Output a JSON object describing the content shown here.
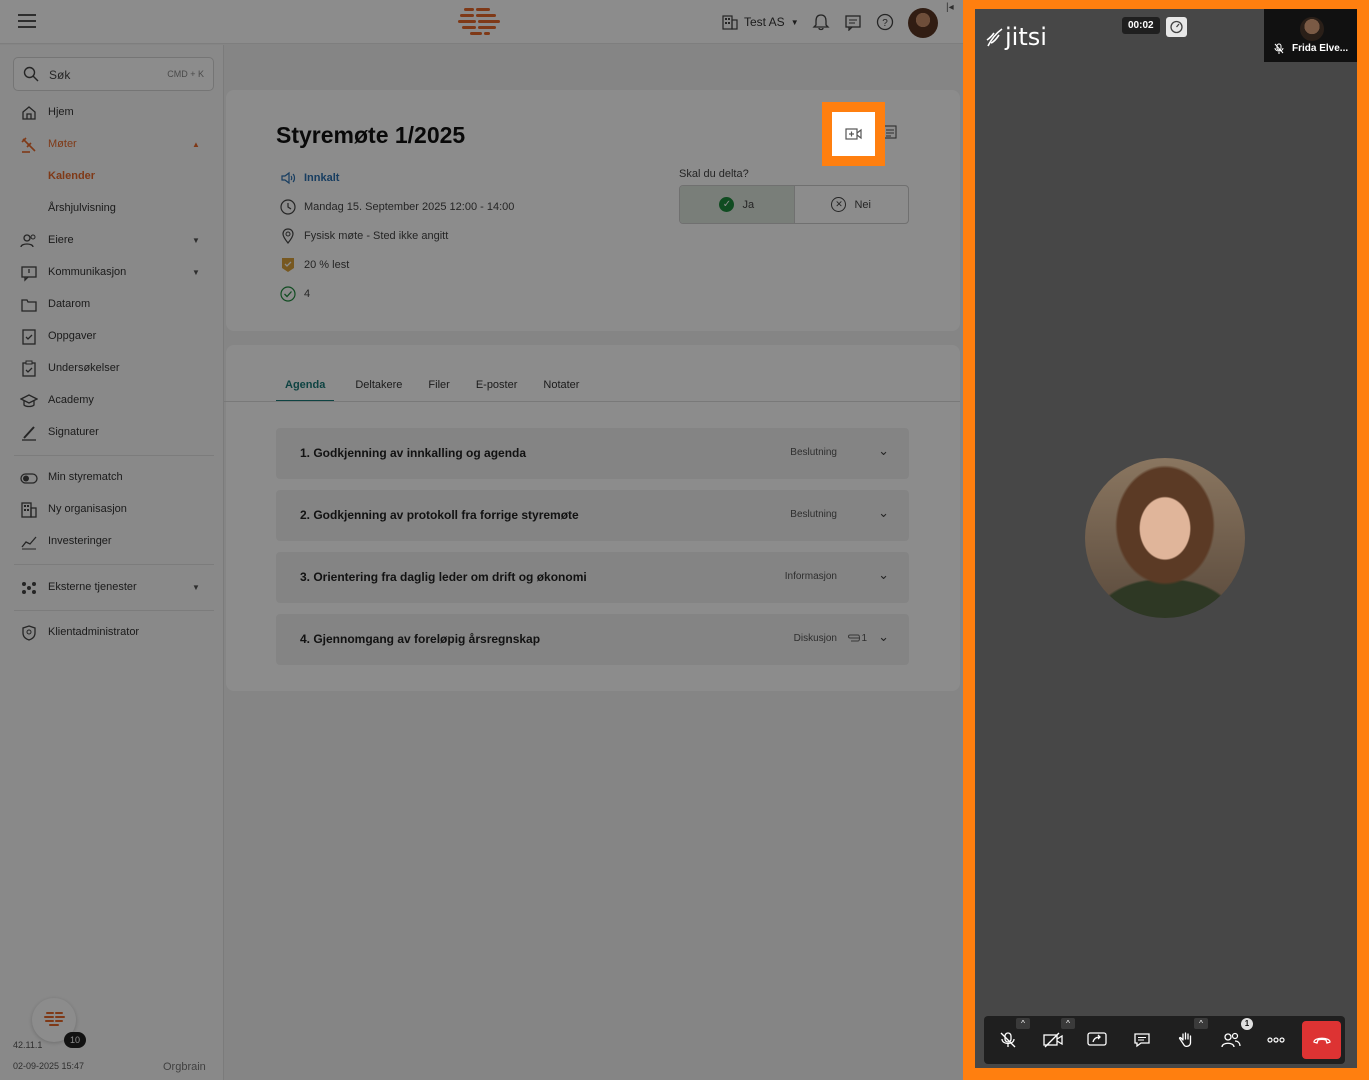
{
  "topbar": {
    "org_name": "Test AS",
    "collapse_glyph": "|◂"
  },
  "sidebar": {
    "search_label": "Søk",
    "search_shortcut": "CMD + K",
    "items": [
      {
        "label": "Hjem",
        "icon": "home-icon"
      },
      {
        "label": "Møter",
        "icon": "gavel-icon"
      },
      {
        "label": "Kalender",
        "icon": ""
      },
      {
        "label": "Årshjulvisning",
        "icon": ""
      },
      {
        "label": "Eiere",
        "icon": "owners-icon"
      },
      {
        "label": "Kommunikasjon",
        "icon": "message-icon"
      },
      {
        "label": "Datarom",
        "icon": "folder-icon"
      },
      {
        "label": "Oppgaver",
        "icon": "task-icon"
      },
      {
        "label": "Undersøkelser",
        "icon": "survey-icon"
      },
      {
        "label": "Academy",
        "icon": "academy-icon"
      },
      {
        "label": "Signaturer",
        "icon": "signature-icon"
      },
      {
        "label": "Min styrematch",
        "icon": "toggle-icon"
      },
      {
        "label": "Ny organisasjon",
        "icon": "building-icon"
      },
      {
        "label": "Investeringer",
        "icon": "chart-icon"
      },
      {
        "label": "Eksterne tjenester",
        "icon": "services-icon"
      },
      {
        "label": "Klientadministrator",
        "icon": "shield-icon"
      }
    ],
    "version": "42.11.1",
    "build_date": "02-09-2025 15:47",
    "brand": "Orgbrain",
    "notification_count": "10"
  },
  "meeting": {
    "title": "Styremøte 1/2025",
    "status": "Innkalt",
    "datetime": "Mandag 15. September 2025 12:00 - 14:00",
    "location": "Fysisk møte - Sted ikke angitt",
    "read": "20 % lest",
    "approvals": "4",
    "rsvp_question": "Skal du delta?",
    "rsvp_yes": "Ja",
    "rsvp_no": "Nei"
  },
  "tabs": [
    "Agenda",
    "Deltakere",
    "Filer",
    "E-poster",
    "Notater"
  ],
  "agenda": [
    {
      "title": "1. Godkjenning av innkalling og agenda",
      "kind": "Beslutning",
      "attachments": ""
    },
    {
      "title": "2. Godkjenning av protokoll fra forrige styremøte",
      "kind": "Beslutning",
      "attachments": ""
    },
    {
      "title": "3. Orientering fra daglig leder om drift og økonomi",
      "kind": "Informasjon",
      "attachments": ""
    },
    {
      "title": "4. Gjennomgang av foreløpig årsregnskap",
      "kind": "Diskusjon",
      "attachments": "1"
    }
  ],
  "jitsi": {
    "logo": "jitsi",
    "timer": "00:02",
    "participant_name": "Frida Elve...",
    "participants_count": "1"
  },
  "colors": {
    "accent_orange": "#ff7f0f",
    "brand_orange": "#e8692a",
    "teal": "#1a7a78",
    "hangup_red": "#dd3333"
  }
}
